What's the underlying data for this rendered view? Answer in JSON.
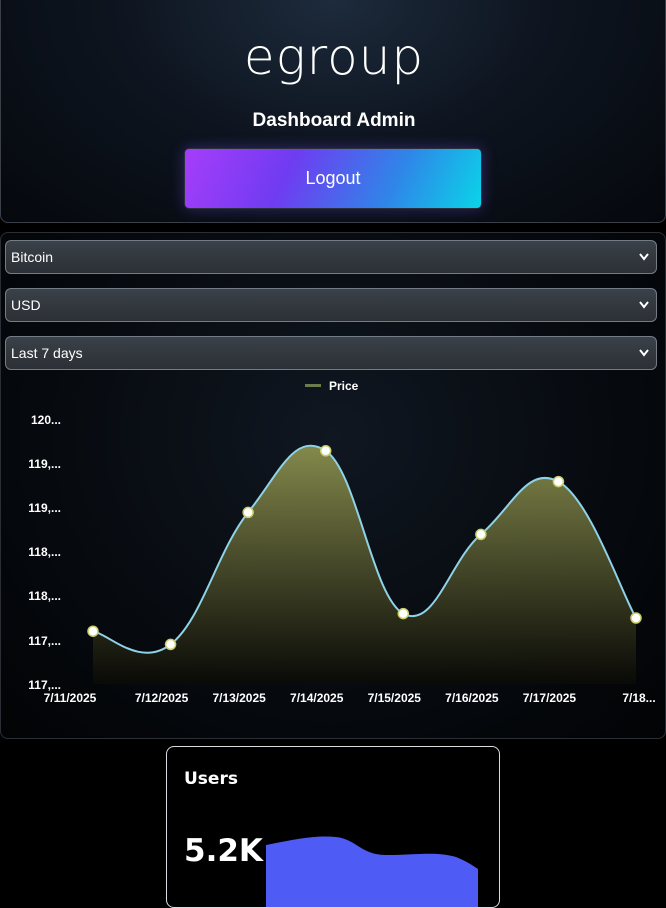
{
  "header": {
    "logo_text": "egroup",
    "title": "Dashboard Admin",
    "logout_label": "Logout"
  },
  "filters": {
    "coin": "Bitcoin",
    "currency": "USD",
    "range": "Last 7 days"
  },
  "colors": {
    "line": "#8fd3e8",
    "area_top": "#8a8f4e",
    "legend_swatch": "#6b7d4a",
    "users_spark": "#4f5bf5"
  },
  "chart_data": {
    "type": "area",
    "legend": [
      "Price"
    ],
    "series": [
      {
        "name": "Price",
        "x": [
          "7/11/2025",
          "7/12/2025",
          "7/13/2025",
          "7/14/2025",
          "7/15/2025",
          "7/16/2025",
          "7/17/2025",
          "7/18..."
        ],
        "values": [
          117100,
          116950,
          118450,
          119150,
          117300,
          118200,
          118800,
          117250
        ]
      }
    ],
    "x_tick_labels": [
      "7/11/2025",
      "7/12/2025",
      "7/13/2025",
      "7/14/2025",
      "7/15/2025",
      "7/16/2025",
      "7/17/2025",
      "7/18..."
    ],
    "y_tick_labels": [
      "120...",
      "119,...",
      "119,...",
      "118,...",
      "118,...",
      "117,...",
      "117,..."
    ],
    "ylim": [
      116500,
      119500
    ],
    "grid": false
  },
  "users": {
    "label": "Users",
    "value": "5.2K"
  }
}
